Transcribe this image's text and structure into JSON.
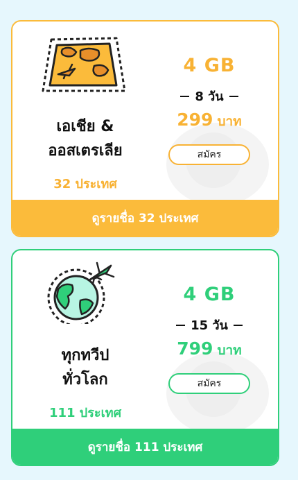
{
  "colors": {
    "orange": "#fbbb3b",
    "green": "#2fcf7a",
    "background": "#e6f7fd"
  },
  "packages": [
    {
      "icon": "asia-australia-map-icon",
      "name_line1": "เอเชีย &",
      "name_line2": "ออสเตรเลีย",
      "countries": "32 ประเทศ",
      "data": "4 GB",
      "days": "8 วัน",
      "price": "299",
      "currency": "บาท",
      "subscribe_label": "สมัคร",
      "footer_label": "ดูรายชื่อ 32 ประเทศ"
    },
    {
      "icon": "globe-airplane-icon",
      "name_line1": "ทุกทวีป",
      "name_line2": "ทั่วโลก",
      "countries": "111 ประเทศ",
      "data": "4 GB",
      "days": "15 วัน",
      "price": "799",
      "currency": "บาท",
      "subscribe_label": "สมัคร",
      "footer_label": "ดูรายชื่อ 111 ประเทศ"
    }
  ]
}
